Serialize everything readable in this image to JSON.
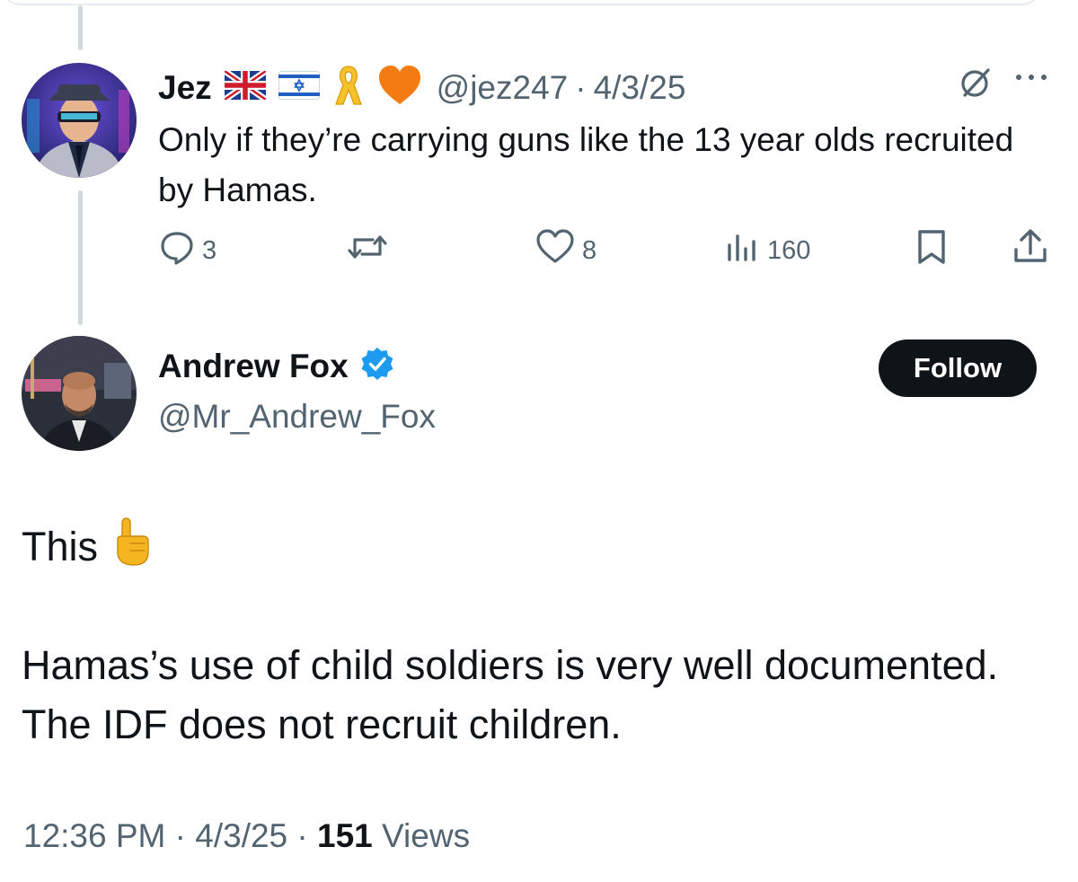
{
  "reply": {
    "name": "Jez",
    "handle": "@jez247",
    "date": "4/3/25",
    "text": "Only if they’re carrying guns like the 13 year olds recruited by Hamas.",
    "replies": "3",
    "likes": "8",
    "views": "160",
    "badges": [
      "uk-flag-icon",
      "israel-flag-icon",
      "yellow-ribbon-icon",
      "orange-heart-icon"
    ]
  },
  "post": {
    "name": "Andrew Fox",
    "handle": "@Mr_Andrew_Fox",
    "follow_label": "Follow",
    "line1": "This",
    "line2": "Hamas’s use of child soldiers is very well documented. The IDF does not recruit children.",
    "time": "12:36 PM",
    "date": "4/3/25",
    "views_count": "151",
    "views_label": "Views"
  },
  "separator": "·",
  "colors": {
    "text": "#0f1419",
    "muted": "#536471",
    "thread_line": "#cfd9de",
    "verified_blue": "#1d9bf0",
    "button_bg": "#0f1419"
  }
}
